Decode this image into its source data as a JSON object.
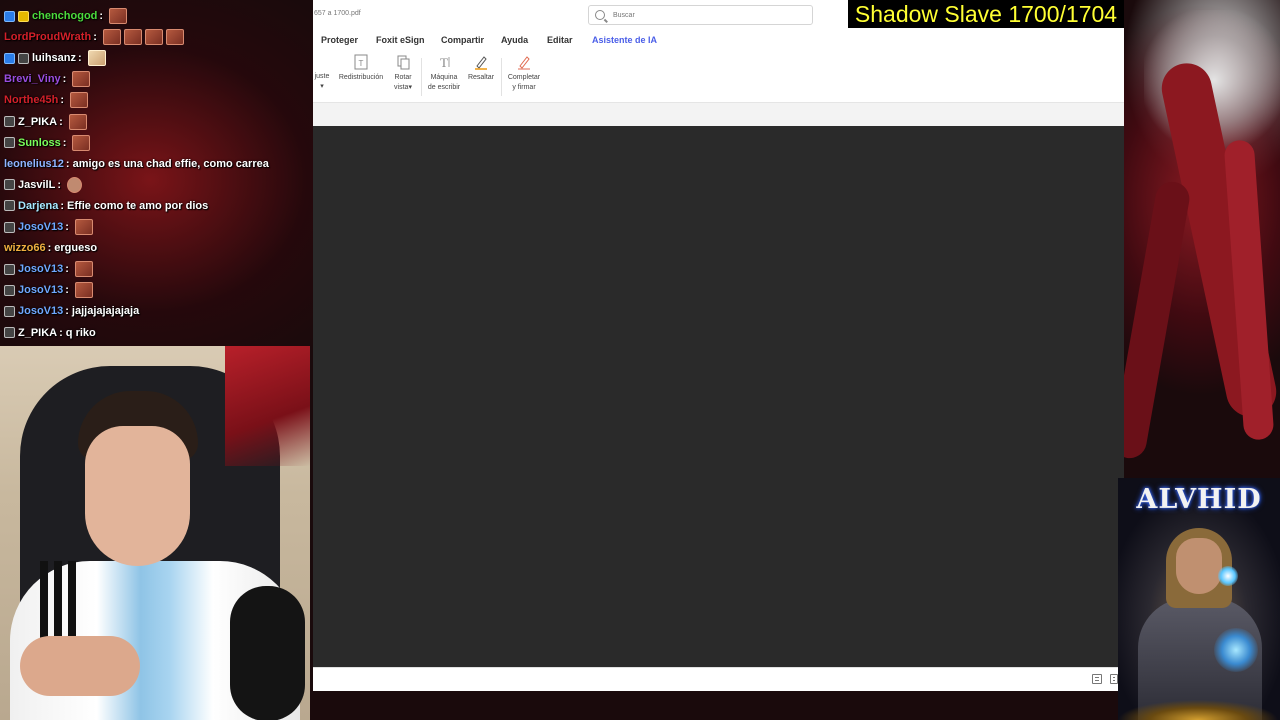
{
  "overlay": {
    "book_title": "Shadow Slave 1700/1704",
    "banner_name": "ALVHID"
  },
  "chat": {
    "messages": [
      {
        "user": "chenchogod",
        "user_color": "#4cdb3c",
        "badges": [
          "blue",
          "crown"
        ],
        "text": "",
        "emotes": [
          "emote"
        ]
      },
      {
        "user": "LordProudWrath",
        "user_color": "#d4202a",
        "badges": [],
        "text": "",
        "emotes": [
          "emote",
          "emote",
          "emote",
          "emote"
        ]
      },
      {
        "user": "luihsanz",
        "user_color": "#ffffff",
        "badges": [
          "blue",
          "plain"
        ],
        "text": "",
        "emotes": [
          "emote-light"
        ]
      },
      {
        "user": "Brevi_Viny",
        "user_color": "#9b4de0",
        "badges": [],
        "text": "",
        "emotes": [
          "emote"
        ]
      },
      {
        "user": "Northe45h",
        "user_color": "#d4202a",
        "badges": [],
        "text": "",
        "emotes": [
          "emote"
        ]
      },
      {
        "user": "Z_PIKA",
        "user_color": "#ffffff",
        "badges": [
          "plain"
        ],
        "text": "",
        "emotes": [
          "emote"
        ]
      },
      {
        "user": "Sunloss",
        "user_color": "#7aff5a",
        "badges": [
          "plain"
        ],
        "text": "",
        "emotes": [
          "emote"
        ]
      },
      {
        "user": "leonelius12",
        "user_color": "#8fb4ff",
        "badges": [],
        "text": "amigo es una chad effie, como carrea",
        "emotes": []
      },
      {
        "user": "JasvilL",
        "user_color": "#ffffff",
        "badges": [
          "plain"
        ],
        "text": "",
        "emotes": [
          "emote-round"
        ]
      },
      {
        "user": "Darjena",
        "user_color": "#a8e8ff",
        "badges": [
          "plain"
        ],
        "text": "Effie como te amo por dios",
        "emotes": []
      },
      {
        "user": "JosoV13",
        "user_color": "#6fa8ff",
        "badges": [
          "plain"
        ],
        "text": "",
        "emotes": [
          "emote"
        ]
      },
      {
        "user": "wizzo66",
        "user_color": "#f0b040",
        "badges": [],
        "text": "ergueso",
        "emotes": []
      },
      {
        "user": "JosoV13",
        "user_color": "#6fa8ff",
        "badges": [
          "plain"
        ],
        "text": "",
        "emotes": [
          "emote"
        ]
      },
      {
        "user": "JosoV13",
        "user_color": "#6fa8ff",
        "badges": [
          "plain"
        ],
        "text": "",
        "emotes": [
          "emote"
        ]
      },
      {
        "user": "JosoV13",
        "user_color": "#6fa8ff",
        "badges": [
          "plain"
        ],
        "text": "jajjajajajajaja",
        "emotes": []
      },
      {
        "user": "Z_PIKA",
        "user_color": "#ffffff",
        "badges": [
          "plain"
        ],
        "text": "q riko",
        "emotes": []
      }
    ]
  },
  "foxit": {
    "filename": "657 a 1700.pdf",
    "search_placeholder": "Buscar",
    "menu": [
      "Proteger",
      "Foxit eSign",
      "Compartir",
      "Ayuda",
      "Editar",
      "Asistente de IA"
    ],
    "tools": {
      "ajuste": "juste",
      "redistribucion": "Redistribución",
      "rotar_1": "Rotar",
      "rotar_2": "vista",
      "maquina_1": "Máquina",
      "maquina_2": "de escribir",
      "resaltar": "Resaltar",
      "completar_1": "Completar",
      "completar_2": "y firmar"
    }
  },
  "colors": {
    "title_text": "#ffff33",
    "ai_menu": "#4a5ee8",
    "doc_background": "#2a2a2a"
  }
}
